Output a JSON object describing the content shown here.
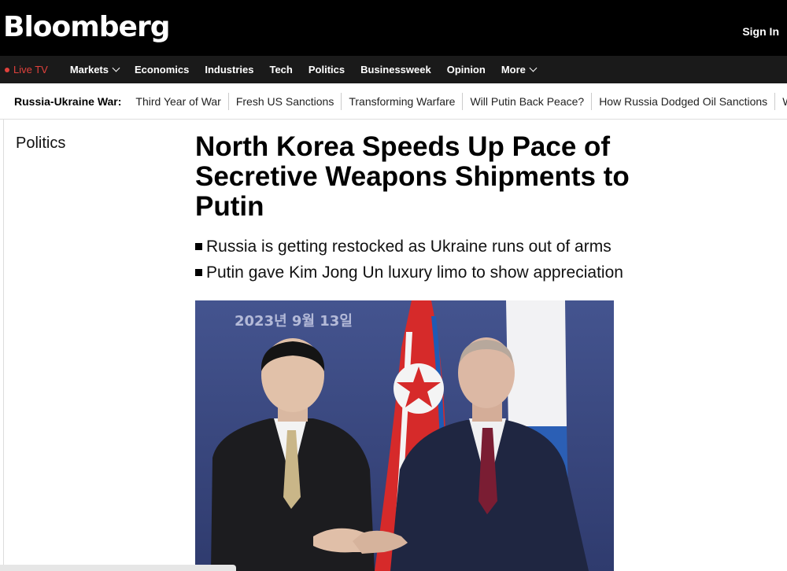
{
  "header": {
    "logo": "Bloomberg",
    "signin": "Sign In"
  },
  "nav": {
    "live": "Live TV",
    "items": [
      {
        "label": "Markets",
        "dropdown": true
      },
      {
        "label": "Economics"
      },
      {
        "label": "Industries"
      },
      {
        "label": "Tech"
      },
      {
        "label": "Politics"
      },
      {
        "label": "Businessweek"
      },
      {
        "label": "Opinion"
      },
      {
        "label": "More",
        "dropdown": true
      }
    ]
  },
  "subnav": {
    "label": "Russia-Ukraine War:",
    "links": [
      "Third Year of War",
      "Fresh US Sanctions",
      "Transforming Warfare",
      "Will Putin Back Peace?",
      "How Russia Dodged Oil Sanctions",
      "W"
    ]
  },
  "article": {
    "section": "Politics",
    "headline": "North Korea Speeds Up Pace of Secretive Weapons Shipments to Putin",
    "bullets": [
      "Russia is getting restocked as Ukraine runs out of arms",
      "Putin gave Kim Jong Un luxury limo to show appreciation"
    ],
    "photo_date": "2023년 9월 13일"
  },
  "colors": {
    "live": "#e0413c",
    "topbar": "#000000",
    "navbar": "#1a1a1a"
  }
}
